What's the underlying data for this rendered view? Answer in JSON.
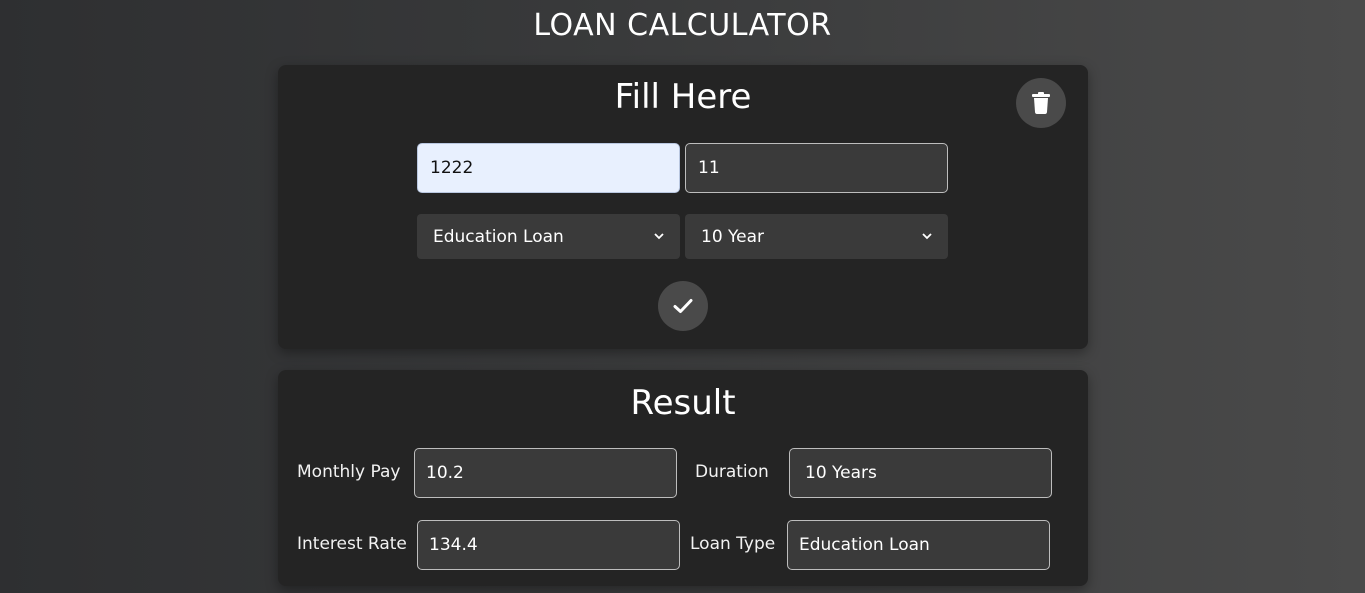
{
  "app": {
    "title": "LOAN CALCULATOR"
  },
  "form": {
    "title": "Fill Here",
    "amount_value": "1222",
    "rate_value": "11",
    "loan_type_selected": "Education Loan",
    "duration_selected": "10 Year",
    "delete_icon": "trash-icon",
    "confirm_icon": "check-icon"
  },
  "result": {
    "title": "Result",
    "monthly_pay_label": "Monthly Pay",
    "monthly_pay_value": "10.2",
    "duration_label": "Duration",
    "duration_value": "10 Years",
    "interest_rate_label": "Interest Rate",
    "interest_rate_value": "134.4",
    "loan_type_label": "Loan Type",
    "loan_type_value": "Education Loan"
  },
  "colors": {
    "card_bg": "#242424",
    "button_bg": "#4a4a4a",
    "field_bg": "#3a3a3a",
    "autofill_bg": "#e8f0fe"
  }
}
